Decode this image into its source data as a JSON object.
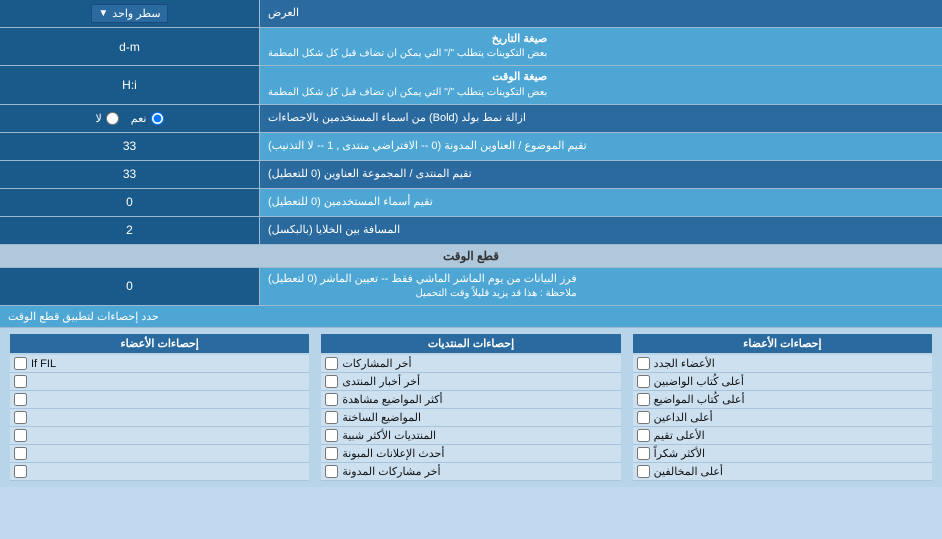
{
  "header": {
    "title": "العرض",
    "dropdown_label": "سطر واحد"
  },
  "rows": [
    {
      "id": "date_format",
      "label": "صيغة التاريخ",
      "sublabel": "بعض التكوينات يتطلب \"/\" التي يمكن ان تضاف قبل كل شكل المطمة",
      "input_value": "d-m",
      "type": "text"
    },
    {
      "id": "time_format",
      "label": "صيغة الوقت",
      "sublabel": "بعض التكوينات يتطلب \"/\" التي يمكن ان تضاف قبل كل شكل المطمة",
      "input_value": "H:i",
      "type": "text"
    },
    {
      "id": "bold_remove",
      "label": "ازالة نمط بولد (Bold) من اسماء المستخدمين بالاحصاءات",
      "type": "radio",
      "options": [
        {
          "value": "yes",
          "label": "نعم",
          "checked": true
        },
        {
          "value": "no",
          "label": "لا",
          "checked": false
        }
      ]
    },
    {
      "id": "topic_sort",
      "label": "تقيم الموضوع / العناوين المدونة (0 -- الافتراضي منتدى , 1 -- لا التذنيب)",
      "input_value": "33",
      "type": "text"
    },
    {
      "id": "forum_sort",
      "label": "تقيم المنتدى / المجموعة العناوين (0 للتعطيل)",
      "input_value": "33",
      "type": "text"
    },
    {
      "id": "user_sort",
      "label": "تقيم أسماء المستخدمين (0 للتعطيل)",
      "input_value": "0",
      "type": "text"
    },
    {
      "id": "cell_spacing",
      "label": "المسافة بين الخلايا (بالبكسل)",
      "input_value": "2",
      "type": "text"
    }
  ],
  "time_cut_section": {
    "title": "قطع الوقت",
    "row": {
      "label": "فرز البيانات من يوم الماشر الماشي فقط -- تعيين الماشر (0 لتعطيل)",
      "note": "ملاحظة : هذا قد يزيد قليلاً وقت التحميل",
      "input_value": "0"
    }
  },
  "apply_stats": {
    "label": "حدد إحصاءات لتطبيق قطع الوقت"
  },
  "checkbox_columns": [
    {
      "header": "إحصاءات الأعضاء",
      "items": [
        "الأعضاء الجدد",
        "أعلى كُتاب الواضبين",
        "أعلى كُتاب المواضيع",
        "أعلى الداعين",
        "الأعلى تقيم",
        "الأكثر شكراً",
        "أعلى المخالفين"
      ]
    },
    {
      "header": "إحصاءات المنتديات",
      "items": [
        "أخر المشاركات",
        "أخر أخبار المنتدى",
        "أكثر المواضيع مشاهدة",
        "المواضيع الساخنة",
        "المنتديات الأكثر شبية",
        "أحدث الإعلانات المبونة",
        "أخر مشاركات المدونة"
      ]
    },
    {
      "header": "إحصاءات الأعضاء",
      "items": [
        "If FIL",
        "",
        "",
        "",
        "",
        "",
        ""
      ]
    }
  ]
}
